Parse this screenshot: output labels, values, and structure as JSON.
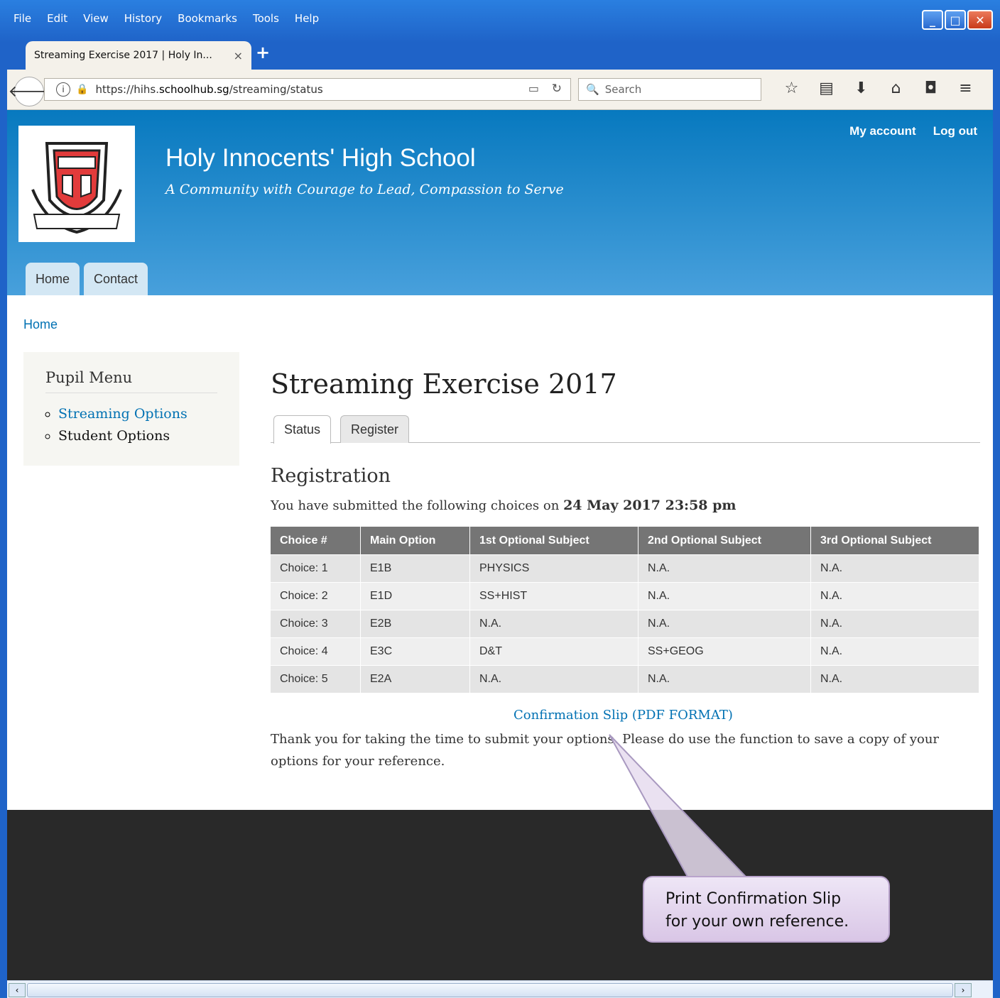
{
  "menu": [
    "File",
    "Edit",
    "View",
    "History",
    "Bookmarks",
    "Tools",
    "Help"
  ],
  "browser": {
    "tab_title": "Streaming Exercise 2017 | Holy In...",
    "tab_close": "×",
    "new_tab": "+",
    "url_prefix": "https://hihs.",
    "url_domain": "schoolhub.sg",
    "url_path": "/streaming/status",
    "search_placeholder": "Search"
  },
  "site": {
    "name": "Holy Innocents' High School",
    "slogan": "A Community with Courage to Lead, Compassion to Serve",
    "secondary_menu": [
      "My account",
      "Log out"
    ],
    "nav_tabs": [
      "Home",
      "Contact"
    ]
  },
  "breadcrumb": "Home",
  "sidebar": {
    "title": "Pupil Menu",
    "items": [
      {
        "label": "Streaming Options",
        "link": true
      },
      {
        "label": "Student Options",
        "link": false
      }
    ]
  },
  "main": {
    "title": "Streaming Exercise 2017",
    "tabs": [
      "Status",
      "Register"
    ],
    "section_heading": "Registration",
    "submitted_prefix": "You have submitted the following choices on",
    "submitted_date": "24 May 2017 23:58 pm",
    "table": {
      "headers": [
        "Choice #",
        "Main Option",
        "1st Optional Subject",
        "2nd Optional Subject",
        "3rd Optional Subject"
      ],
      "rows": [
        [
          "Choice: 1",
          "E1B",
          "PHYSICS",
          "N.A.",
          "N.A."
        ],
        [
          "Choice: 2",
          "E1D",
          "SS+HIST",
          "N.A.",
          "N.A."
        ],
        [
          "Choice: 3",
          "E2B",
          "N.A.",
          "N.A.",
          "N.A."
        ],
        [
          "Choice: 4",
          "E3C",
          "D&T",
          "SS+GEOG",
          "N.A."
        ],
        [
          "Choice: 5",
          "E2A",
          "N.A.",
          "N.A.",
          "N.A."
        ]
      ]
    },
    "pdf_link": "Confirmation Slip (PDF FORMAT)",
    "thanks": "Thank you for taking the time to submit your options. Please do use the function to save a copy of your options for your reference."
  },
  "callout": {
    "line1": "Print Confirmation Slip",
    "line2": "for your own reference."
  },
  "colors": {
    "header_top": "#0779bf",
    "header_bottom": "#48a0dc",
    "link": "#0071b3",
    "table_header": "#757575",
    "footer": "#292929"
  }
}
